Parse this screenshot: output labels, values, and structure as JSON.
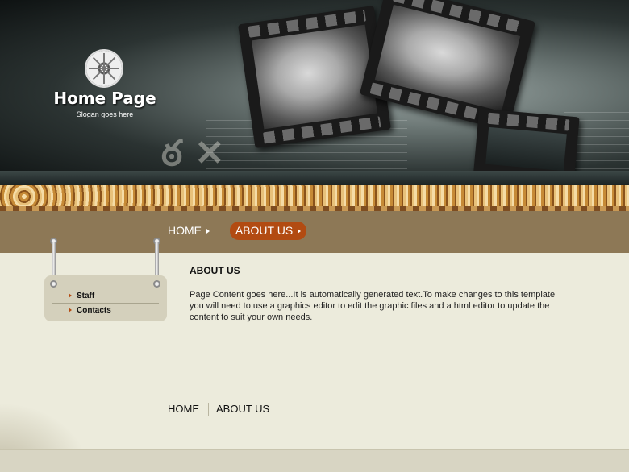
{
  "header": {
    "title": "Home Page",
    "slogan": "Slogan goes here"
  },
  "nav": {
    "items": [
      {
        "label": "HOME",
        "active": false
      },
      {
        "label": "ABOUT US",
        "active": true
      }
    ]
  },
  "sidebar": {
    "items": [
      {
        "label": "Staff"
      },
      {
        "label": "Contacts"
      }
    ]
  },
  "content": {
    "title": "ABOUT US",
    "body": "Page Content goes here...It is automatically generated text.To make changes to this template you will need to use a graphics editor to edit the graphic files and a html editor to update the content to suit your own needs."
  },
  "footer_nav": {
    "items": [
      {
        "label": "HOME"
      },
      {
        "label": "ABOUT US"
      }
    ]
  },
  "colors": {
    "accent": "#b24b12",
    "nav_band": "#8d7856",
    "page_bg": "#ecebdc"
  }
}
